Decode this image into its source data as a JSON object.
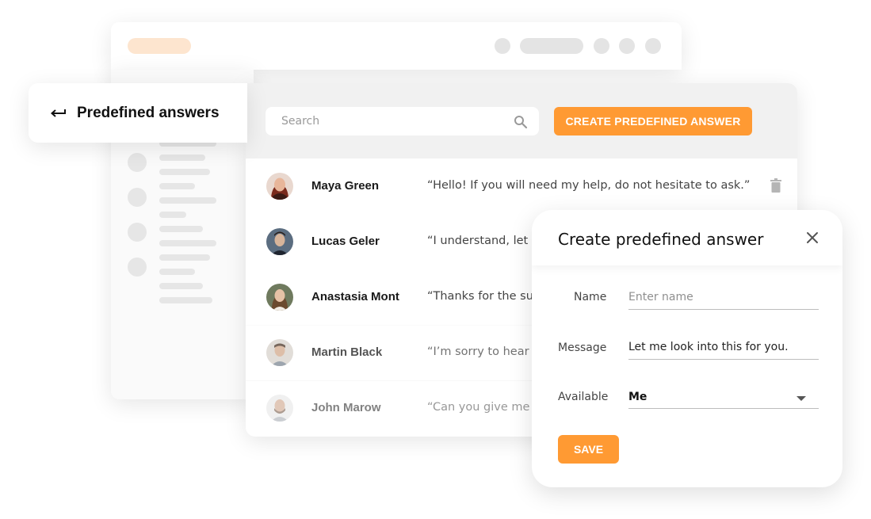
{
  "header": {
    "title": "Predefined answers"
  },
  "toolbar": {
    "search_placeholder": "Search",
    "create_label": "CREATE PREDEFINED ANSWER"
  },
  "answers": [
    {
      "name": "Maya Green",
      "message": "“Hello! If you will need my help, do not hesitate to ask.”"
    },
    {
      "name": "Lucas Geler",
      "message": "“I understand, let me"
    },
    {
      "name": "Anastasia Mont",
      "message": "“Thanks for the sugg"
    },
    {
      "name": "Martin Black",
      "message": "“I’m sorry to hear yo"
    },
    {
      "name": "John Marow",
      "message": "“Can you give me yo"
    }
  ],
  "modal": {
    "title": "Create predefined answer",
    "name_label": "Name",
    "name_placeholder": "Enter name",
    "message_label": "Message",
    "message_value": "Let me look into this for you.",
    "available_label": "Available",
    "available_value": "Me",
    "save_label": "SAVE"
  },
  "colors": {
    "accent": "#ff9a33",
    "accent_soft": "#fde5cf",
    "skeleton": "#e6e6e6"
  }
}
